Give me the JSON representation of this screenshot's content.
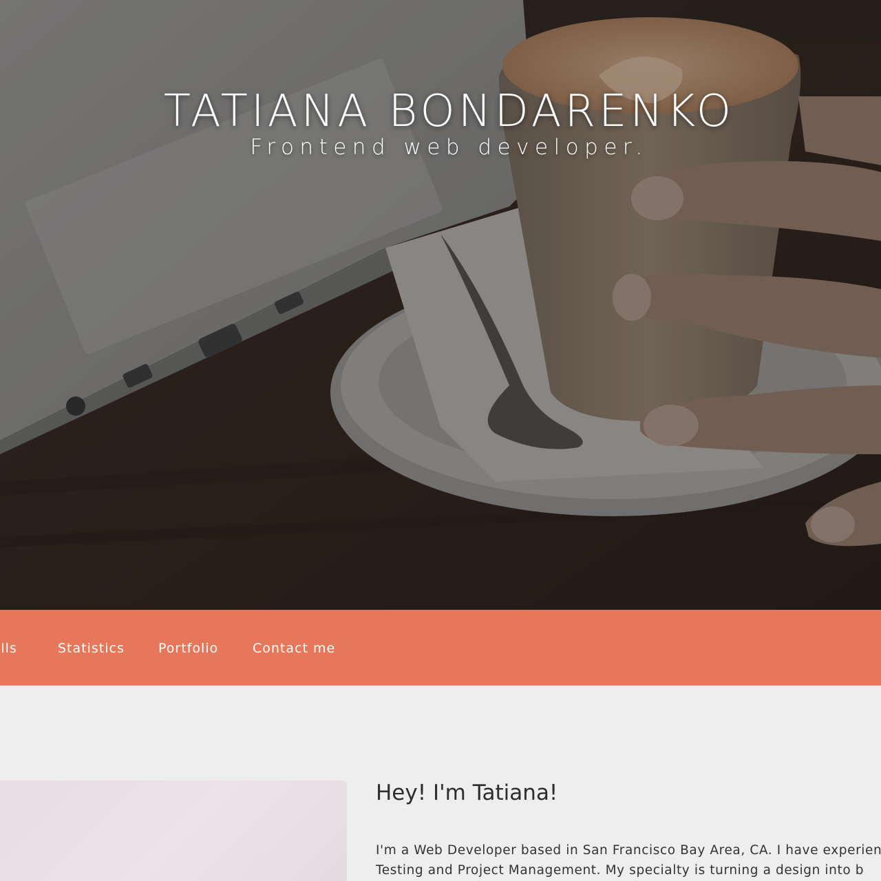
{
  "hero": {
    "title": "TATIANA BONDARENKO",
    "subtitle": "Frontend web developer."
  },
  "nav": {
    "items": [
      {
        "label": "Skills"
      },
      {
        "label": "Statistics"
      },
      {
        "label": "Portfolio"
      },
      {
        "label": "Contact me"
      }
    ],
    "background_color": "#e6775a"
  },
  "about": {
    "heading": "Hey! I'm Tatiana!",
    "text_lines": [
      "I'm a Web Developer based in San Francisco Bay Area, CA. I have experience",
      "Testing and Project Management. My specialty is turning a design into b"
    ]
  },
  "colors": {
    "accent": "#e6775a",
    "page_background": "#eeeeee",
    "hero_text": "#ffffff",
    "heading_text": "#2d2d2d"
  }
}
